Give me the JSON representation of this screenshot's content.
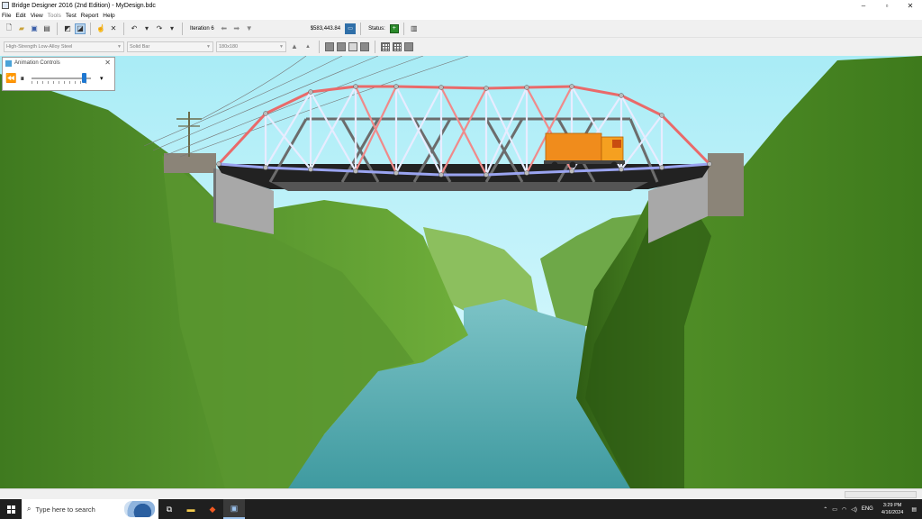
{
  "window": {
    "title": "Bridge Designer 2016 (2nd Edition) - MyDesign.bdc",
    "controls": {
      "minimize": "–",
      "maximize": "▫",
      "close": "✕"
    }
  },
  "menu": [
    "File",
    "Edit",
    "View",
    "Tools",
    "Test",
    "Report",
    "Help"
  ],
  "toolbar": {
    "iteration_label": "Iteration 6",
    "cost": "$583,443.84",
    "status_label": "Status:",
    "status_value": "+"
  },
  "selectors": {
    "material": "High-Strength Low-Alloy Steel",
    "cross_section": "Solid Bar",
    "size": "180x180"
  },
  "animation_controls": {
    "title": "Animation Controls",
    "speed_fraction": 0.92
  },
  "taskbar": {
    "search_placeholder": "Type here to search",
    "language": "ENG",
    "time": "3:29 PM",
    "date": "4/16/2024"
  },
  "colors": {
    "sky": "#b8f0f8",
    "hills": "#4f8a2a",
    "river": "#4aa3a8",
    "compression_member": "#e96a6a",
    "tension_member": "#9aa4f0",
    "truck": "#f08c1c",
    "status_ok": "#2b8a2b"
  }
}
